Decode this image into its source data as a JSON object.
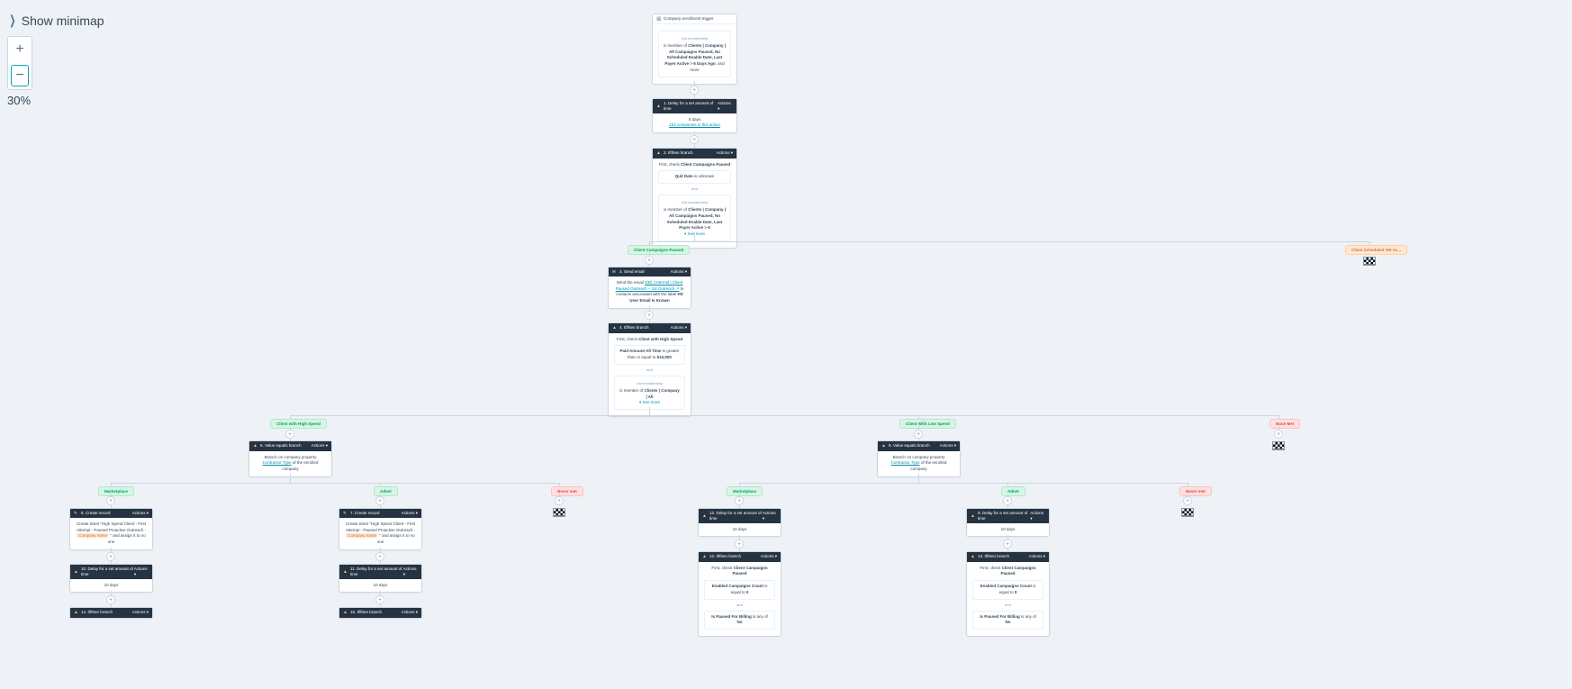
{
  "controls": {
    "minimap_label": "Show minimap",
    "zoom_level": "30%",
    "zoom_in": "+",
    "zoom_out": "−"
  },
  "labels": {
    "actions": "Actions ▾",
    "and": "and",
    "see_more": "▾ See more",
    "list_membership": "List membership"
  },
  "trigger": {
    "title": "Company enrollment trigger",
    "line1_prefix": "is member of ",
    "line1_link": "Clients | Company | All Campaigns Paused, No Scheduled Enable Date, Last Payer Active > 6 Days Ago",
    "line1_suffix": ", and more"
  },
  "n1": {
    "title": "1. Delay for a set amount of time",
    "days": "5 days",
    "count_link": "153 companies in this action"
  },
  "n2": {
    "title": "2. If/then branch",
    "check_prefix": "First, check ",
    "check_bold": "Client Campaigns Paused",
    "cond1_bold": "Quit Date",
    "cond1_rest": " is unknown",
    "lm_prefix": "is member of ",
    "lm_link": "Clients | Company | All Campaigns Paused, No Scheduled Enable Date, Last Payer Active > 6"
  },
  "branch_pills": {
    "ccp": "Client Campaigns Paused",
    "cs_or": "Client Scheduled OR Ac...",
    "chs": "Client with High Spend",
    "cls": "Client With Low Spend",
    "none": "None Met",
    "mkt": "Marketplace",
    "adnet": "Adnet",
    "never": "Never met"
  },
  "n3": {
    "title": "3. Send email",
    "prefix": "Send the email ",
    "link": "3(B) | Internal | Client Paused Outreach – 1st Outreach ↗",
    "mid": " to contacts associated with the label ",
    "bold": "HS User Email Is Known"
  },
  "n4": {
    "title": "4. If/then branch",
    "check_prefix": "First, check ",
    "check_bold": "Client with High Spend",
    "cond1_bold": "Paid Amount All Time",
    "cond1_rest": " is greater than or equal to ",
    "cond1_val": "$10,000",
    "lm_prefix": "is member of ",
    "lm_link": "Clients | Company | All"
  },
  "n5": {
    "title": "5. Value equals branch",
    "text_prefix": "Branch on company property ",
    "text_link": "Contractor Type",
    "text_suffix": " of the enrolled company"
  },
  "n6": {
    "title": "6. Value equals branch"
  },
  "n8": {
    "title": "8. Create record",
    "l1": "Create ticket \"High Spend Client - First Attempt - Paused Proactive Outreach - ",
    "token": "Company name",
    "l2": " \" and assign it to no one"
  },
  "n7": {
    "title": "7. Create record",
    "l1": "Create ticket \"High Spend Client - First Attempt - Paused Proactive Outreach - ",
    "token": "Company name",
    "l2": " \" and assign it to no one"
  },
  "n10": {
    "title": "10. Delay for a set amount of time",
    "days": "10 days"
  },
  "n11": {
    "title": "11. Delay for a set amount of time",
    "days": "10 days"
  },
  "n12d": {
    "title": "12. Delay for a set amount of time",
    "days": "10 days"
  },
  "n9d": {
    "title": "9. Delay for a set amount of time",
    "days": "10 days"
  },
  "n14": {
    "title": "14. If/then branch"
  },
  "n15": {
    "title": "15. If/then branch"
  },
  "n12b": {
    "title": "12. If/then branch",
    "check_prefix": "First, check ",
    "check_bold": "Client Campaigns Paused",
    "c1_bold": "Enabled Campaigns Count",
    "c1_rest": " is equal to ",
    "c1_val": "0",
    "c2_bold": "Is Paused For Billing",
    "c2_rest": " is any of ",
    "c2_val": "No"
  },
  "n13b": {
    "title": "13. If/then branch"
  }
}
